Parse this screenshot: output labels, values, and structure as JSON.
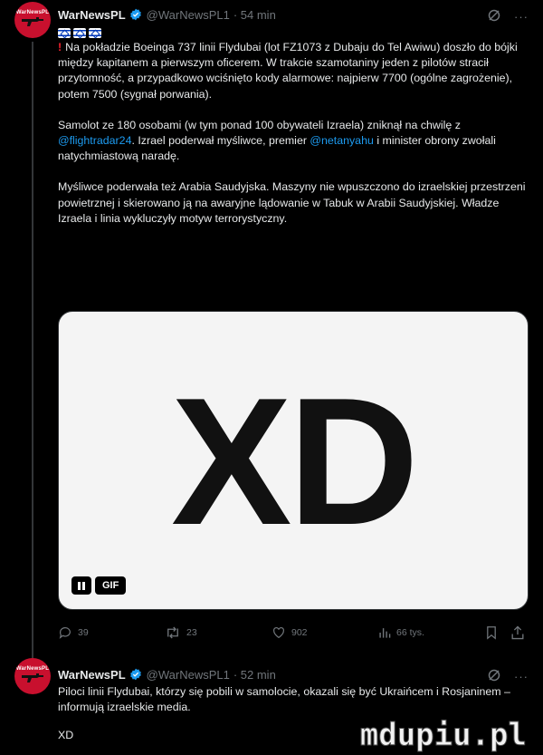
{
  "tweet1": {
    "display_name": "WarNewsPL",
    "handle": "@WarNewsPL1",
    "time": "· 54 min",
    "avatar_text": "WarNewsPL",
    "paragraphs": [
      {
        "prefix": "!",
        "text": "Na pokładzie Boeinga 737 linii Flydubai (lot FZ1073 z Dubaju do Tel Awiwu) doszło do bójki między kapitanem a pierwszym oficerem. W trakcie szamotaniny jeden z pilotów stracił przytomność, a przypadkowo wciśnięto kody alarmowe: najpierw 7700 (ogólne zagrożenie), potem 7500 (sygnał porwania)."
      },
      {
        "part1": "Samolot ze 180 osobami (w tym ponad 100 obywateli Izraela) zniknął na chwilę z ",
        "mention1": "@flightradar24",
        "part2": ". Izrael poderwał myśliwce, premier ",
        "mention2": "@netanyahu",
        "part3": " i minister obrony zwołali natychmiastową naradę."
      },
      {
        "text": "Myśliwce poderwała też Arabia Saudyjska. Maszyny nie wpuszczono do izraelskiej przestrzeni powietrznej i skierowano ją na awaryjne lądowanie w Tabuk w Arabii Saudyjskiej. Władze Izraela i linia wykluczyły motyw terrorystyczny."
      }
    ],
    "media": {
      "caption": "XD",
      "gif_label": "GIF"
    },
    "actions": {
      "replies": "39",
      "reposts": "23",
      "likes": "902",
      "views": "66 tys."
    }
  },
  "tweet2": {
    "display_name": "WarNewsPL",
    "handle": "@WarNewsPL1",
    "time": "· 52 min",
    "avatar_text": "WarNewsPL",
    "text": "Piloci linii Flydubai, którzy się pobili w samolocie, okazali się być Ukraińcem i Rosjaninem – informują izraelskie media.",
    "text2": "XD"
  },
  "watermark": "mdupiu.pl",
  "colors": {
    "background": "#000000",
    "text": "#e7e9ea",
    "muted": "#71767b",
    "link": "#1d9bf0",
    "verified": "#1d9bf0",
    "avatar": "#c8102e"
  },
  "icons": {
    "verified": "verified-badge-icon",
    "grok": "grok-icon",
    "more": "more-icon",
    "reply": "reply-icon",
    "repost": "repost-icon",
    "like": "like-icon",
    "views": "views-icon",
    "bookmark": "bookmark-icon",
    "share": "share-icon",
    "pause": "pause-icon"
  }
}
